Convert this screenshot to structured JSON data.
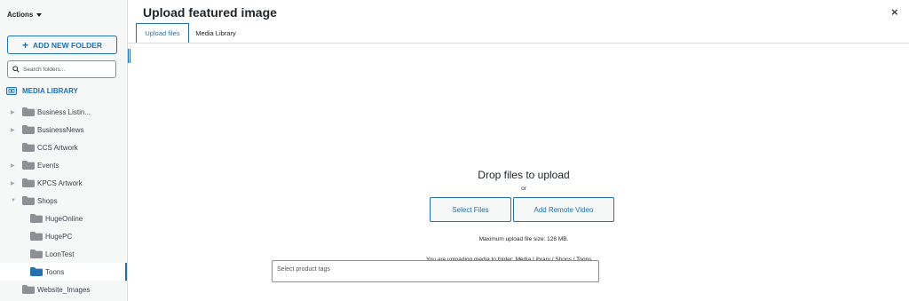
{
  "sidebar": {
    "actions_label": "Actions",
    "add_folder_label": "ADD NEW FOLDER",
    "search_placeholder": "Search folders...",
    "media_library_label": "MEDIA LIBRARY",
    "folders": [
      {
        "label": "Business Listin..."
      },
      {
        "label": "BusinessNews"
      },
      {
        "label": "CCS Artwork"
      },
      {
        "label": "Events"
      },
      {
        "label": "KPCS Artwork"
      },
      {
        "label": "Shops"
      },
      {
        "label": "HugeOnline"
      },
      {
        "label": "HugePC"
      },
      {
        "label": "LoonTest"
      },
      {
        "label": "Toons"
      },
      {
        "label": "Website_Images"
      }
    ]
  },
  "modal": {
    "title": "Upload featured image",
    "close_label": "×",
    "tabs": [
      {
        "label": "Upload files"
      },
      {
        "label": "Media Library"
      }
    ]
  },
  "uploader": {
    "drop_title": "Drop files to upload",
    "or_label": "or",
    "select_files_label": "Select Files",
    "remote_video_label": "Add Remote Video",
    "max_size_label": "Maximum upload file size: 128 MB.",
    "uploading_prefix": "You are uploading media to folder:",
    "uploading_path": "Media Library / Shops / Toons"
  },
  "tags": {
    "placeholder": "Select product tags"
  },
  "colors": {
    "accent": "#2271b1",
    "folder": "#8c8f94",
    "folder_active": "#2271b1"
  }
}
